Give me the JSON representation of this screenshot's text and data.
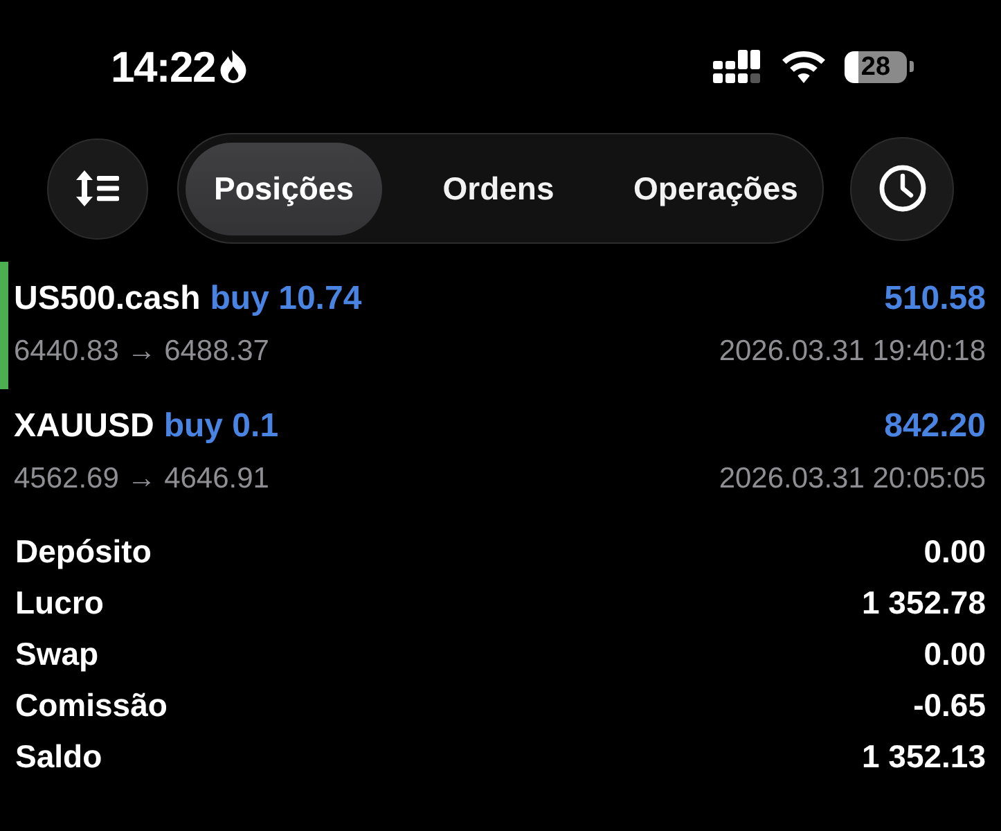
{
  "status_bar": {
    "time": "14:22",
    "battery": "28"
  },
  "toolbar": {
    "tabs": [
      {
        "label": "Posições",
        "selected": true
      },
      {
        "label": "Ordens",
        "selected": false
      },
      {
        "label": "Operações",
        "selected": false
      }
    ]
  },
  "positions": [
    {
      "symbol": "US500.cash",
      "trade": "buy 10.74",
      "profit": "510.58",
      "prices": "6440.83 → 6488.37",
      "time": "2026.03.31 19:40:18",
      "selected": true
    },
    {
      "symbol": "XAUUSD",
      "trade": "buy 0.1",
      "profit": "842.20",
      "prices": "4562.69 → 4646.91",
      "time": "2026.03.31 20:05:05",
      "selected": false
    }
  ],
  "summary": [
    {
      "label": "Depósito",
      "value": "0.00"
    },
    {
      "label": "Lucro",
      "value": "1 352.78"
    },
    {
      "label": "Swap",
      "value": "0.00"
    },
    {
      "label": "Comissão",
      "value": "-0.65"
    },
    {
      "label": "Saldo",
      "value": "1 352.13"
    }
  ]
}
